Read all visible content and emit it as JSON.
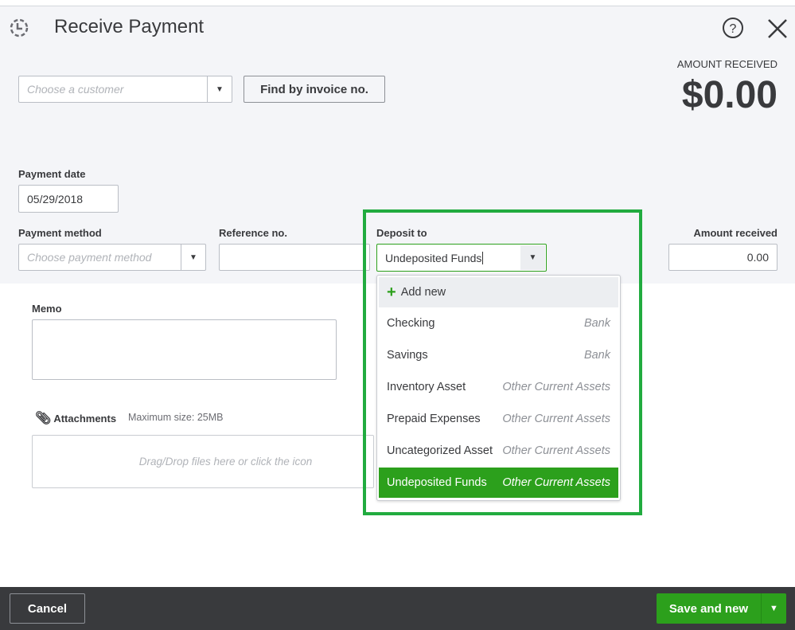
{
  "header": {
    "title": "Receive Payment",
    "amount_label": "AMOUNT RECEIVED",
    "amount": "$0.00"
  },
  "customer": {
    "placeholder": "Choose a customer",
    "find_button": "Find by invoice no."
  },
  "payment_date": {
    "label": "Payment date",
    "value": "05/29/2018"
  },
  "payment_method": {
    "label": "Payment method",
    "placeholder": "Choose payment method"
  },
  "reference": {
    "label": "Reference no.",
    "value": ""
  },
  "deposit": {
    "label": "Deposit to",
    "value": "Undeposited Funds",
    "add_new": "Add new",
    "options": [
      {
        "name": "Checking",
        "type": "Bank"
      },
      {
        "name": "Savings",
        "type": "Bank"
      },
      {
        "name": "Inventory Asset",
        "type": "Other Current Assets"
      },
      {
        "name": "Prepaid Expenses",
        "type": "Other Current Assets"
      },
      {
        "name": "Uncategorized Asset",
        "type": "Other Current Assets"
      },
      {
        "name": "Undeposited Funds",
        "type": "Other Current Assets"
      }
    ]
  },
  "amount_received": {
    "label": "Amount received",
    "value": "0.00"
  },
  "memo": {
    "label": "Memo"
  },
  "attachments": {
    "label": "Attachments",
    "max": "Maximum size: 25MB",
    "drop": "Drag/Drop files here or click the icon"
  },
  "footer": {
    "cancel": "Cancel",
    "save": "Save and new"
  },
  "colors": {
    "accent": "#2ca01c",
    "footer": "#393a3d",
    "highlight": "#21ab3f"
  }
}
